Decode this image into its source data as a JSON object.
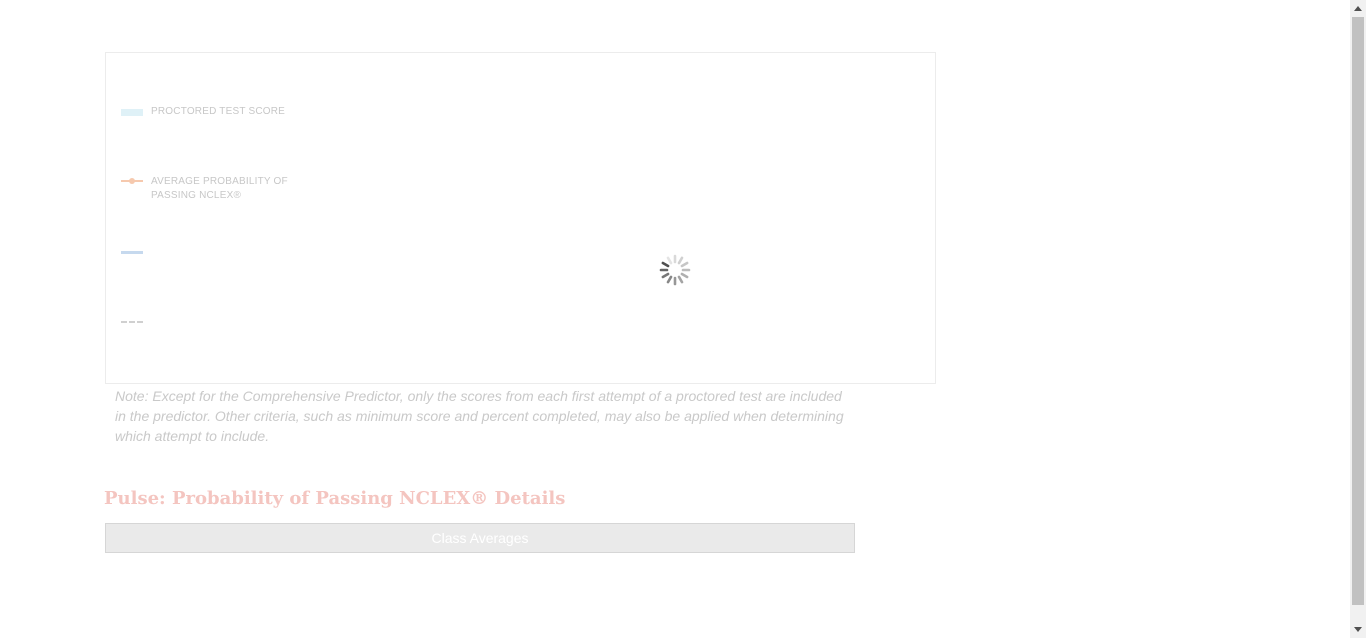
{
  "legend": {
    "items": [
      {
        "label": "PROCTORED TEST SCORE",
        "swatch": "bar",
        "color": "#dff1f7"
      },
      {
        "label": "AVERAGE PROBABILITY OF PASSING NCLEX®",
        "swatch": "line-marker",
        "color": "#f6c9ae"
      },
      {
        "label": "",
        "swatch": "line",
        "color": "#c6d9ee"
      },
      {
        "label": "",
        "swatch": "dashed-line",
        "color": "#d0d0d0"
      }
    ]
  },
  "loading_indicator": "spinner-icon",
  "note": "Note: Except for the Comprehensive Predictor, only the scores from each first attempt of a proctored test are included in the predictor. Other criteria, such as minimum score and percent completed, may also be applied when determining which attempt to include.",
  "section": {
    "title": "Pulse: Probability of Passing NCLEX® Details",
    "class_averages_label": "Class Averages"
  },
  "colors": {
    "title": "#f4c5c0",
    "note_text": "#c9c9c9",
    "panel_border": "#ececec"
  }
}
